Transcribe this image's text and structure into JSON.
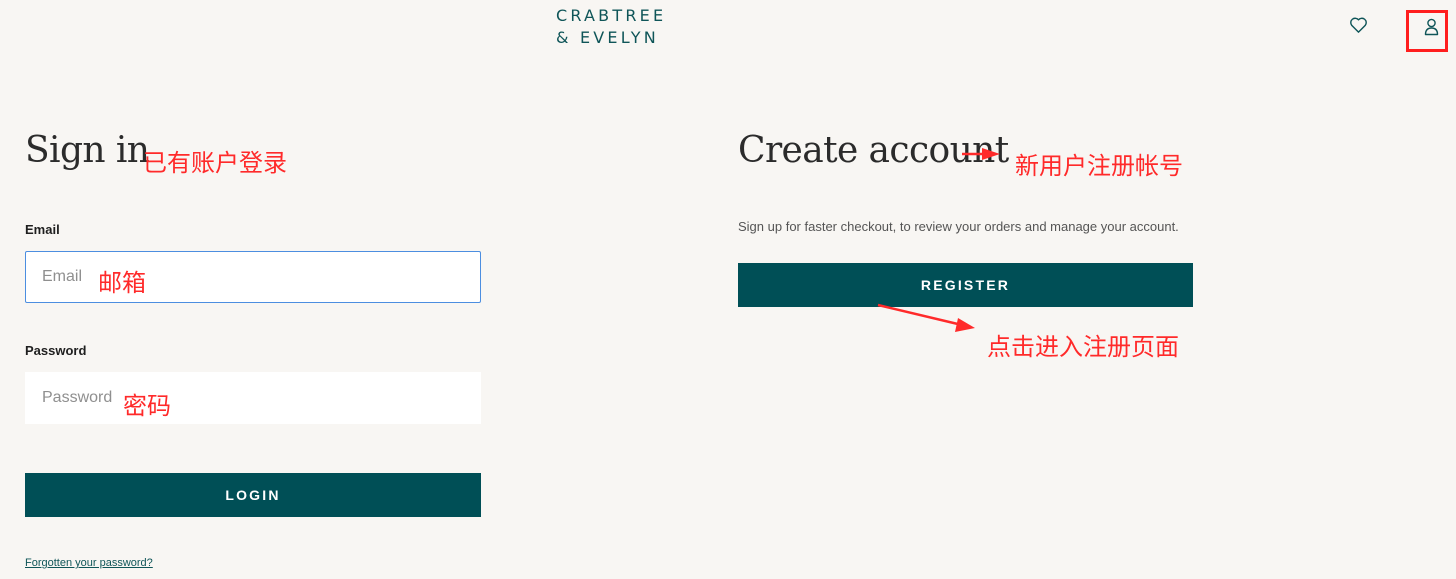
{
  "header": {
    "logo_line1": "CRABTREE",
    "logo_line2": "& EVELYN",
    "wishlist_icon": "heart-icon",
    "account_icon": "user-icon"
  },
  "signin": {
    "title": "Sign in",
    "annotation": "已有账户登录",
    "email_label": "Email",
    "email_placeholder": "Email",
    "email_annotation": "邮箱",
    "password_label": "Password",
    "password_placeholder": "Password",
    "password_annotation": "密码",
    "login_label": "LOGIN",
    "forgot_label": "Forgotten your password?"
  },
  "create": {
    "title": "Create account",
    "annotation": "新用户注册帐号",
    "description": "Sign up for faster checkout, to review your orders and manage your account.",
    "register_label": "REGISTER",
    "register_annotation": "点击进入注册页面"
  },
  "colors": {
    "background": "#f8f6f3",
    "brand": "#004f56",
    "annotation": "#ff2a2a",
    "focus": "#4c8ee0"
  }
}
